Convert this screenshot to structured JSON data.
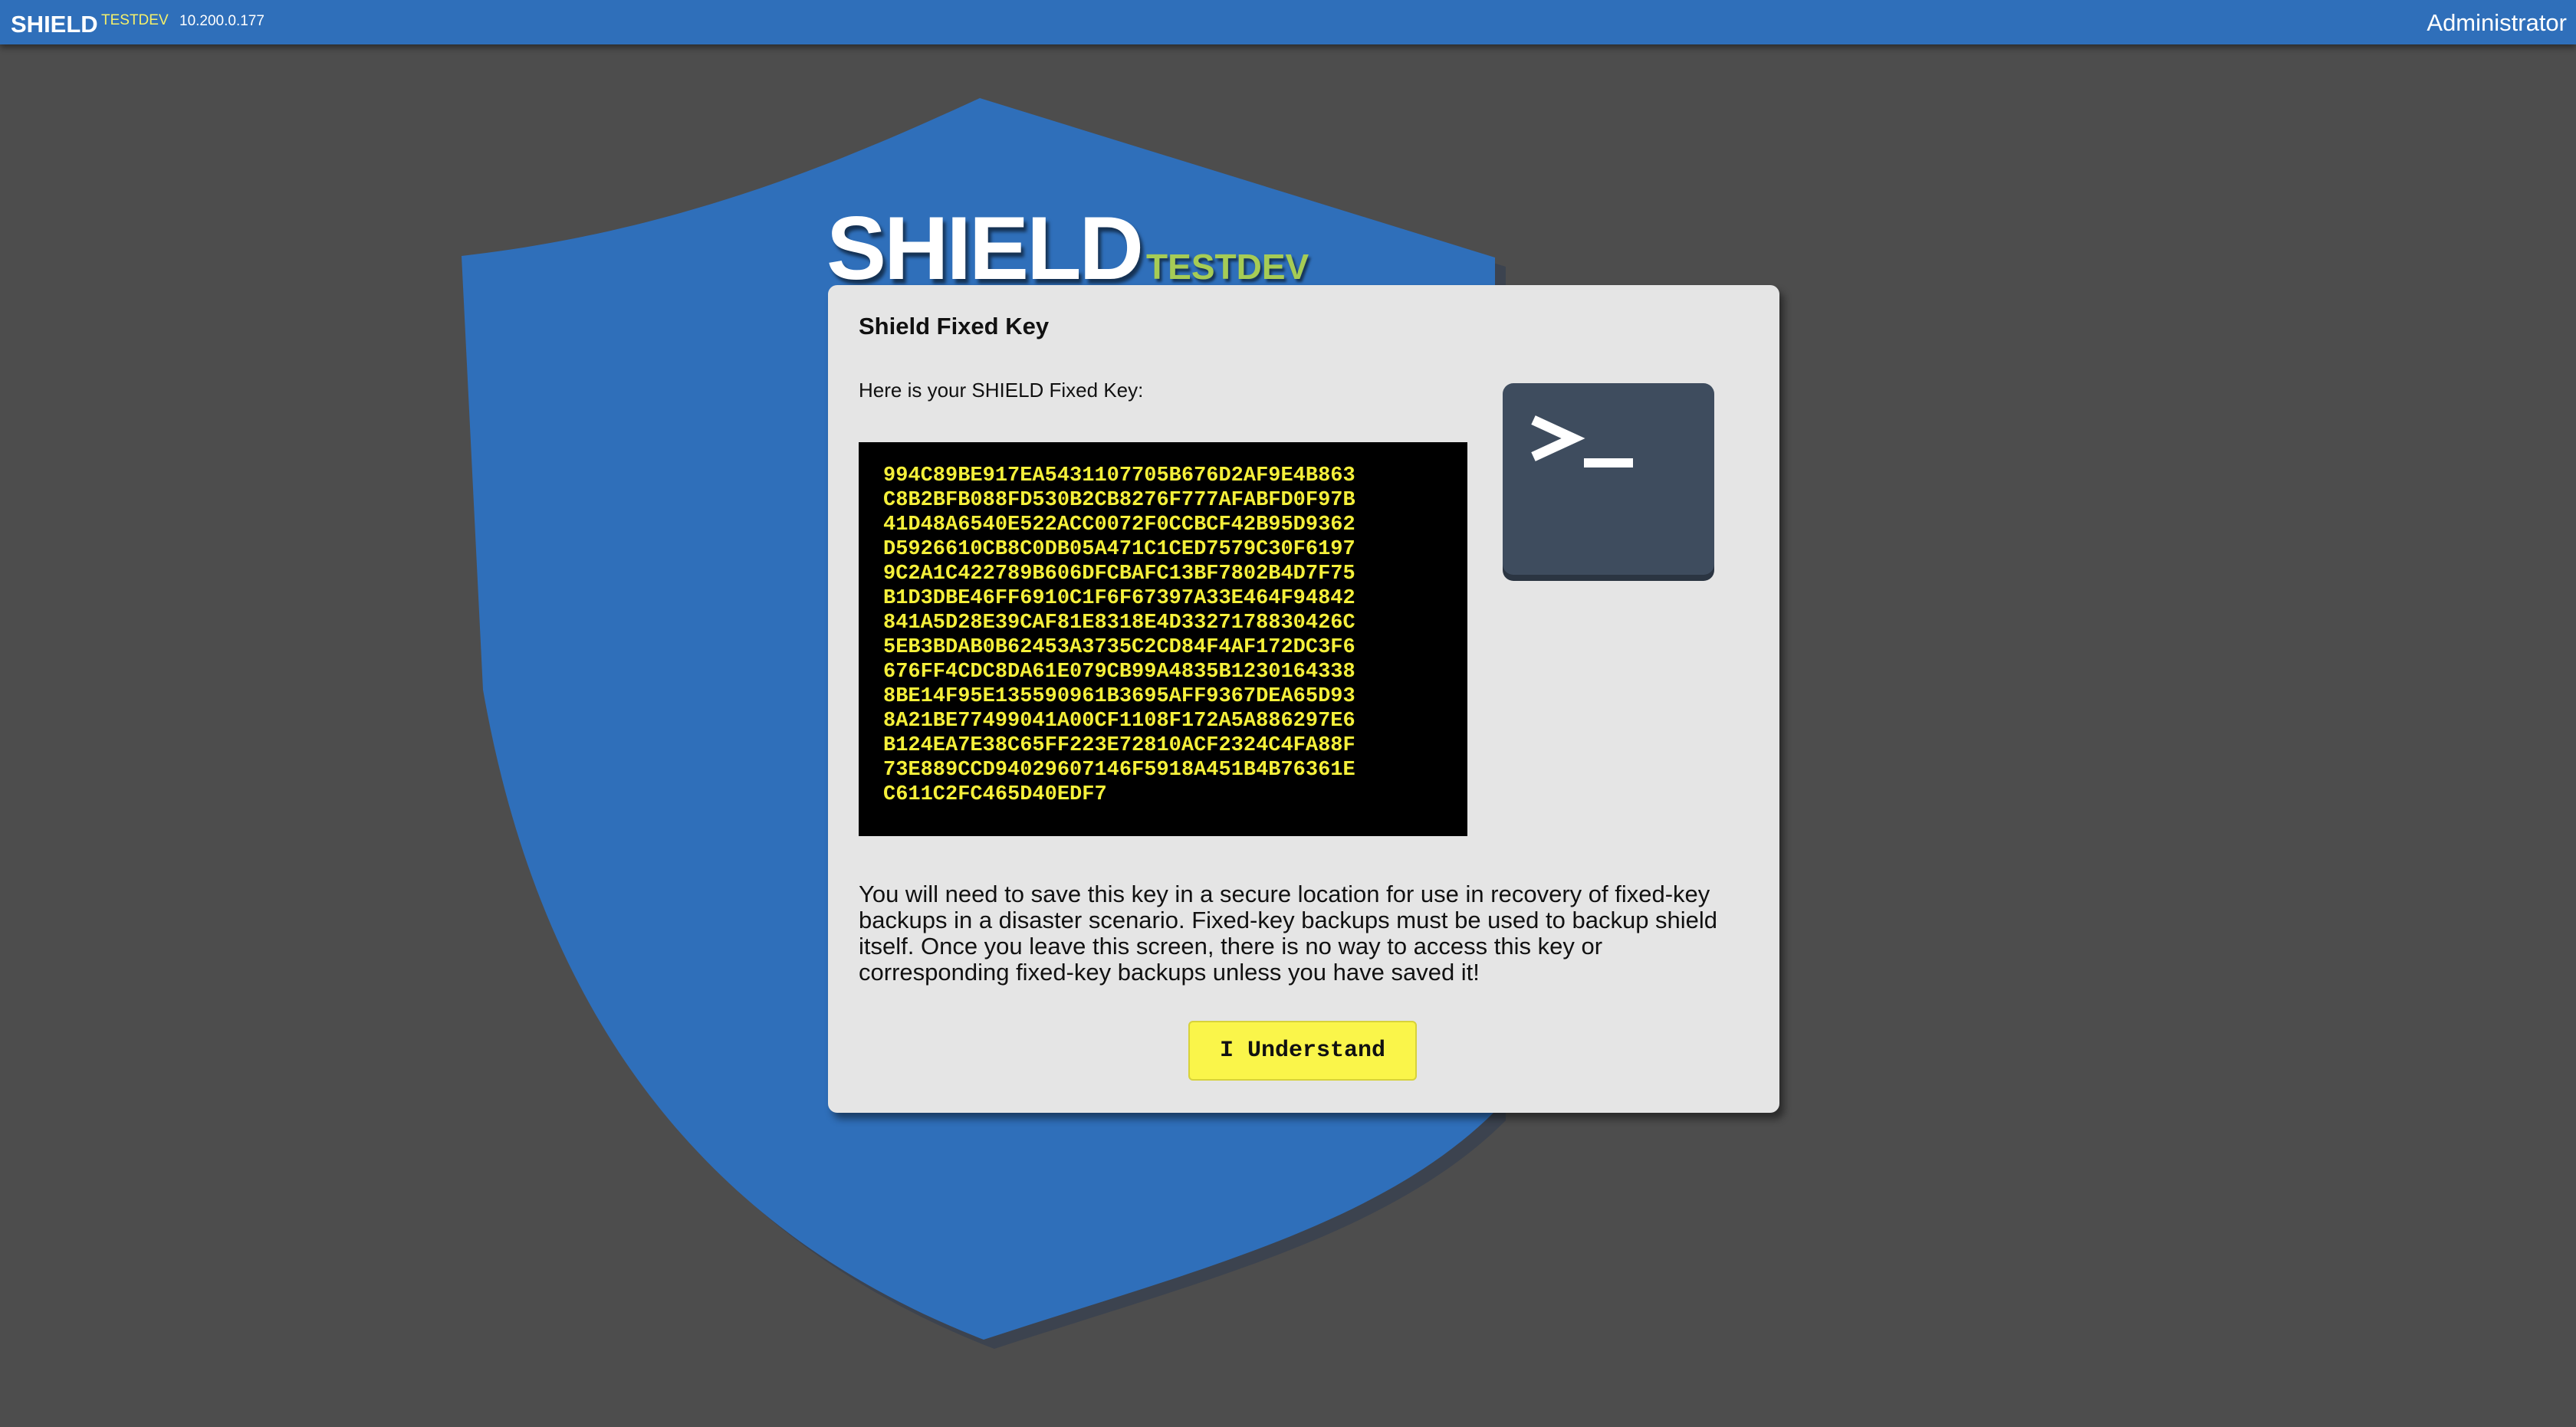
{
  "topbar": {
    "brand": "SHIELD",
    "environment": "TESTDEV",
    "ip": "10.200.0.177",
    "user": "Administrator"
  },
  "logo": {
    "title": "SHIELD",
    "environment": "TESTDEV"
  },
  "card": {
    "title": "Shield Fixed Key",
    "intro": "Here is your SHIELD Fixed Key:",
    "key_lines": [
      "994C89BE917EA5431107705B676D2AF9E4B863",
      "C8B2BFB088FD530B2CB8276F777AFABFD0F97B",
      "41D48A6540E522ACC0072F0CCBCF42B95D9362",
      "D5926610CB8C0DB05A471C1CED7579C30F6197",
      "9C2A1C422789B606DFCBAFC13BF7802B4D7F75",
      "B1D3DBE46FF6910C1F6F67397A33E464F94842",
      "841A5D28E39CAF81E8318E4D3327178830426C",
      "5EB3BDAB0B62453A3735C2CD84F4AF172DC3F6",
      "676FF4CDC8DA61E079CB99A4835B1230164338",
      "8BE14F95E135590961B3695AFF9367DEA65D93",
      "8A21BE77499041A00CF1108F172A5A886297E6",
      "B124EA7E38C65FF223E72810ACF2324C4FA88F",
      "73E889CCD94029607146F5918A451B4B76361E",
      "C611C2FC465D40EDF7"
    ],
    "warning": "You will need to save this key in a secure location for use in recovery of fixed-key backups in a disaster scenario. Fixed-key backups must be used to backup shield itself. Once you leave this screen, there is no way to access this key or corresponding fixed-key backups unless you have saved it!",
    "button_label": "I Understand",
    "terminal_icon": "terminal-icon"
  },
  "colors": {
    "topbar": "#2f6fba",
    "background": "#4d4d4d",
    "shield": "#2f6fba",
    "environment_topbar": "#f5f06a",
    "environment_logo": "#a6cc55",
    "key_text": "#f5f03a",
    "button": "#faf54a"
  }
}
